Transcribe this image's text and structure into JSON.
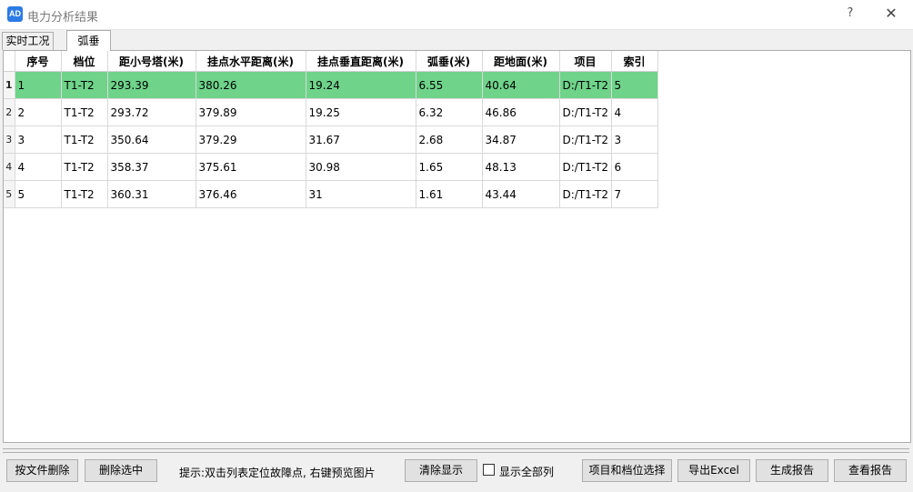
{
  "window": {
    "title": "电力分析结果",
    "app_icon_text": "AD",
    "help_symbol": "?",
    "close_symbol": "✕"
  },
  "tabs": [
    {
      "label": "实时工况",
      "active": false
    },
    {
      "label": "弧垂",
      "active": true
    }
  ],
  "table": {
    "columns": [
      "序号",
      "档位",
      "距小号塔(米)",
      "挂点水平距离(米)",
      "挂点垂直距离(米)",
      "弧垂(米)",
      "距地面(米)",
      "项目",
      "索引"
    ],
    "selected_row": 0,
    "rows": [
      {
        "header": "1",
        "cells": [
          "1",
          "T1-T2",
          "293.39",
          "380.26",
          "19.24",
          "6.55",
          "40.64",
          "D:/T1-T2",
          "5"
        ]
      },
      {
        "header": "2",
        "cells": [
          "2",
          "T1-T2",
          "293.72",
          "379.89",
          "19.25",
          "6.32",
          "46.86",
          "D:/T1-T2",
          "4"
        ]
      },
      {
        "header": "3",
        "cells": [
          "3",
          "T1-T2",
          "350.64",
          "379.29",
          "31.67",
          "2.68",
          "34.87",
          "D:/T1-T2",
          "3"
        ]
      },
      {
        "header": "4",
        "cells": [
          "4",
          "T1-T2",
          "358.37",
          "375.61",
          "30.98",
          "1.65",
          "48.13",
          "D:/T1-T2",
          "6"
        ]
      },
      {
        "header": "5",
        "cells": [
          "5",
          "T1-T2",
          "360.31",
          "376.46",
          "31",
          "1.61",
          "43.44",
          "D:/T1-T2",
          "7"
        ]
      }
    ]
  },
  "footer": {
    "delete_by_file": "按文件删除",
    "delete_selected": "删除选中",
    "hint": "提示:双击列表定位故障点, 右键预览图片",
    "clear_display": "清除显示",
    "show_all_columns": "显示全部列",
    "show_all_checked": false,
    "project_span_select": "项目和档位选择",
    "export_excel": "导出Excel",
    "generate_report": "生成报告",
    "view_report": "查看报告"
  },
  "colors": {
    "selected_row": "#6fd38a",
    "app_icon": "#2d7be5"
  }
}
